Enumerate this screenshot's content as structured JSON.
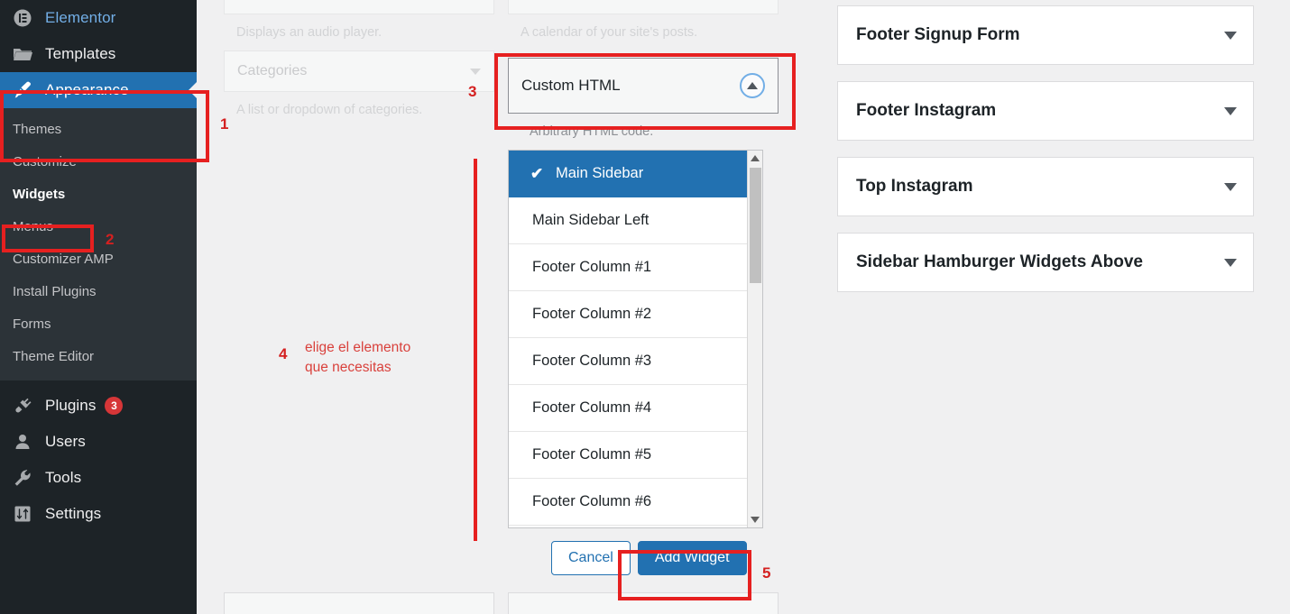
{
  "sidebar": {
    "top_items": [
      {
        "label": "Elementor",
        "icon": "elementor-icon",
        "badge": null,
        "state": "normal"
      },
      {
        "label": "Templates",
        "icon": "folder-icon",
        "badge": null,
        "state": "normal"
      },
      {
        "label": "Appearance",
        "icon": "paintbrush-icon",
        "badge": null,
        "state": "current"
      }
    ],
    "sub_items": [
      {
        "label": "Themes",
        "highlight": false
      },
      {
        "label": "Customize",
        "highlight": false
      },
      {
        "label": "Widgets",
        "highlight": true
      },
      {
        "label": "Menus",
        "highlight": false
      },
      {
        "label": "Customizer AMP",
        "highlight": false
      },
      {
        "label": "Install Plugins",
        "highlight": false
      },
      {
        "label": "Forms",
        "highlight": false
      },
      {
        "label": "Theme Editor",
        "highlight": false
      }
    ],
    "bottom_items": [
      {
        "label": "Plugins",
        "icon": "plug-icon",
        "badge": "3"
      },
      {
        "label": "Users",
        "icon": "user-icon",
        "badge": null
      },
      {
        "label": "Tools",
        "icon": "wrench-icon",
        "badge": null
      },
      {
        "label": "Settings",
        "icon": "sliders-icon",
        "badge": null
      }
    ]
  },
  "available_widgets": {
    "left_column": [
      {
        "title": "",
        "description": "Displays an audio player.",
        "faded": true,
        "partial": true
      },
      {
        "title": "Categories",
        "description": "A list or dropdown of categories.",
        "faded": true,
        "partial": false
      }
    ],
    "right_column": [
      {
        "title": "",
        "description": "A calendar of your site's posts.",
        "faded": true,
        "partial": true
      }
    ],
    "selected_widget": {
      "title": "Custom HTML",
      "description": "Arbitrary HTML code.",
      "toggle_icon": "caret-up-circle-icon"
    }
  },
  "sidebar_select": {
    "options": [
      {
        "label": "Main Sidebar",
        "selected": true
      },
      {
        "label": "Main Sidebar Left",
        "selected": false
      },
      {
        "label": "Footer Column #1",
        "selected": false
      },
      {
        "label": "Footer Column #2",
        "selected": false
      },
      {
        "label": "Footer Column #3",
        "selected": false
      },
      {
        "label": "Footer Column #4",
        "selected": false
      },
      {
        "label": "Footer Column #5",
        "selected": false
      },
      {
        "label": "Footer Column #6",
        "selected": false
      }
    ],
    "check_glyph": "✔",
    "scrollbar": {
      "up_arrow": "▲",
      "down_arrow": "▼"
    }
  },
  "actions": {
    "cancel_label": "Cancel",
    "add_widget_label": "Add Widget"
  },
  "widget_areas": [
    {
      "title": "Footer Signup Form"
    },
    {
      "title": "Footer Instagram"
    },
    {
      "title": "Top Instagram"
    },
    {
      "title": "Sidebar Hamburger Widgets Above"
    }
  ],
  "annotations": {
    "step1": "1",
    "step2": "2",
    "step3": "3",
    "step4_number": "4",
    "step4_line1": "elige el elemento",
    "step4_line2": "que necesitas",
    "step5": "5"
  },
  "colors": {
    "admin_dark": "#1d2327",
    "admin_submenu": "#2c3338",
    "wp_blue": "#2271b1",
    "annotation_red": "#e62020",
    "badge_red": "#d63638",
    "page_bg": "#f0f0f1"
  }
}
